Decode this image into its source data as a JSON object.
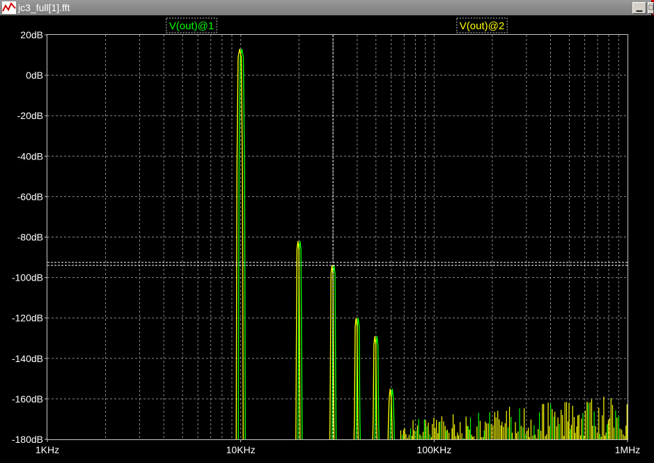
{
  "window": {
    "title": "jc3_full[1].fft"
  },
  "chart_data": {
    "type": "line",
    "title": "",
    "xscale": "log",
    "xlim": [
      1000,
      1000000
    ],
    "ylim": [
      -180,
      20
    ],
    "xticks": [
      {
        "value": 1000,
        "label": "1KHz"
      },
      {
        "value": 10000,
        "label": "10KHz"
      },
      {
        "value": 100000,
        "label": "100KHz"
      },
      {
        "value": 1000000,
        "label": "1MHz"
      }
    ],
    "yticks": [
      {
        "value": 20,
        "label": "20dB"
      },
      {
        "value": 0,
        "label": "0dB"
      },
      {
        "value": -20,
        "label": "-20dB"
      },
      {
        "value": -40,
        "label": "-40dB"
      },
      {
        "value": -60,
        "label": "-60dB"
      },
      {
        "value": -80,
        "label": "-80dB"
      },
      {
        "value": -100,
        "label": "-100dB"
      },
      {
        "value": -120,
        "label": "-120dB"
      },
      {
        "value": -140,
        "label": "-140dB"
      },
      {
        "value": -160,
        "label": "-160dB"
      },
      {
        "value": -180,
        "label": "-180dB"
      }
    ],
    "grid": true,
    "series": [
      {
        "name": "V(out)@1",
        "color": "#00ff00"
      },
      {
        "name": "V(out)@2",
        "color": "#ffff00"
      }
    ],
    "peaks": [
      {
        "x": 10000,
        "y": 13
      },
      {
        "x": 20000,
        "y": -82
      },
      {
        "x": 30000,
        "y": -94
      },
      {
        "x": 40000,
        "y": -120
      },
      {
        "x": 50000,
        "y": -129
      },
      {
        "x": 60000,
        "y": -155
      }
    ],
    "cursor": {
      "x": 30000,
      "y": [
        -92.5,
        -94
      ]
    },
    "noise_floor": {
      "from": 60000,
      "to": 1000000,
      "min": -180,
      "max": -156
    }
  }
}
